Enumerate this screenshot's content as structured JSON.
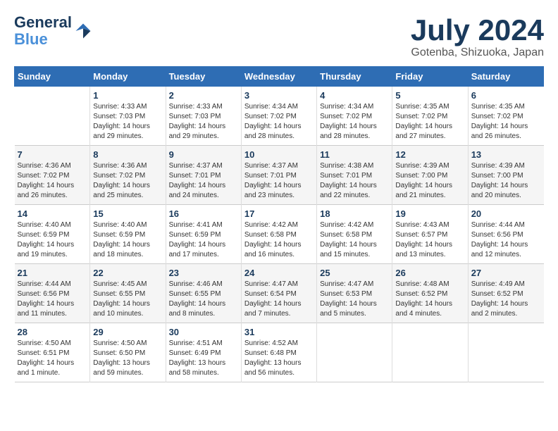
{
  "header": {
    "logo_line1": "General",
    "logo_line2": "Blue",
    "month_title": "July 2024",
    "subtitle": "Gotenba, Shizuoka, Japan"
  },
  "calendar": {
    "days_of_week": [
      "Sunday",
      "Monday",
      "Tuesday",
      "Wednesday",
      "Thursday",
      "Friday",
      "Saturday"
    ],
    "weeks": [
      [
        {
          "day": "",
          "info": ""
        },
        {
          "day": "1",
          "info": "Sunrise: 4:33 AM\nSunset: 7:03 PM\nDaylight: 14 hours\nand 29 minutes."
        },
        {
          "day": "2",
          "info": "Sunrise: 4:33 AM\nSunset: 7:03 PM\nDaylight: 14 hours\nand 29 minutes."
        },
        {
          "day": "3",
          "info": "Sunrise: 4:34 AM\nSunset: 7:02 PM\nDaylight: 14 hours\nand 28 minutes."
        },
        {
          "day": "4",
          "info": "Sunrise: 4:34 AM\nSunset: 7:02 PM\nDaylight: 14 hours\nand 28 minutes."
        },
        {
          "day": "5",
          "info": "Sunrise: 4:35 AM\nSunset: 7:02 PM\nDaylight: 14 hours\nand 27 minutes."
        },
        {
          "day": "6",
          "info": "Sunrise: 4:35 AM\nSunset: 7:02 PM\nDaylight: 14 hours\nand 26 minutes."
        }
      ],
      [
        {
          "day": "7",
          "info": "Sunrise: 4:36 AM\nSunset: 7:02 PM\nDaylight: 14 hours\nand 26 minutes."
        },
        {
          "day": "8",
          "info": "Sunrise: 4:36 AM\nSunset: 7:02 PM\nDaylight: 14 hours\nand 25 minutes."
        },
        {
          "day": "9",
          "info": "Sunrise: 4:37 AM\nSunset: 7:01 PM\nDaylight: 14 hours\nand 24 minutes."
        },
        {
          "day": "10",
          "info": "Sunrise: 4:37 AM\nSunset: 7:01 PM\nDaylight: 14 hours\nand 23 minutes."
        },
        {
          "day": "11",
          "info": "Sunrise: 4:38 AM\nSunset: 7:01 PM\nDaylight: 14 hours\nand 22 minutes."
        },
        {
          "day": "12",
          "info": "Sunrise: 4:39 AM\nSunset: 7:00 PM\nDaylight: 14 hours\nand 21 minutes."
        },
        {
          "day": "13",
          "info": "Sunrise: 4:39 AM\nSunset: 7:00 PM\nDaylight: 14 hours\nand 20 minutes."
        }
      ],
      [
        {
          "day": "14",
          "info": "Sunrise: 4:40 AM\nSunset: 6:59 PM\nDaylight: 14 hours\nand 19 minutes."
        },
        {
          "day": "15",
          "info": "Sunrise: 4:40 AM\nSunset: 6:59 PM\nDaylight: 14 hours\nand 18 minutes."
        },
        {
          "day": "16",
          "info": "Sunrise: 4:41 AM\nSunset: 6:59 PM\nDaylight: 14 hours\nand 17 minutes."
        },
        {
          "day": "17",
          "info": "Sunrise: 4:42 AM\nSunset: 6:58 PM\nDaylight: 14 hours\nand 16 minutes."
        },
        {
          "day": "18",
          "info": "Sunrise: 4:42 AM\nSunset: 6:58 PM\nDaylight: 14 hours\nand 15 minutes."
        },
        {
          "day": "19",
          "info": "Sunrise: 4:43 AM\nSunset: 6:57 PM\nDaylight: 14 hours\nand 13 minutes."
        },
        {
          "day": "20",
          "info": "Sunrise: 4:44 AM\nSunset: 6:56 PM\nDaylight: 14 hours\nand 12 minutes."
        }
      ],
      [
        {
          "day": "21",
          "info": "Sunrise: 4:44 AM\nSunset: 6:56 PM\nDaylight: 14 hours\nand 11 minutes."
        },
        {
          "day": "22",
          "info": "Sunrise: 4:45 AM\nSunset: 6:55 PM\nDaylight: 14 hours\nand 10 minutes."
        },
        {
          "day": "23",
          "info": "Sunrise: 4:46 AM\nSunset: 6:55 PM\nDaylight: 14 hours\nand 8 minutes."
        },
        {
          "day": "24",
          "info": "Sunrise: 4:47 AM\nSunset: 6:54 PM\nDaylight: 14 hours\nand 7 minutes."
        },
        {
          "day": "25",
          "info": "Sunrise: 4:47 AM\nSunset: 6:53 PM\nDaylight: 14 hours\nand 5 minutes."
        },
        {
          "day": "26",
          "info": "Sunrise: 4:48 AM\nSunset: 6:52 PM\nDaylight: 14 hours\nand 4 minutes."
        },
        {
          "day": "27",
          "info": "Sunrise: 4:49 AM\nSunset: 6:52 PM\nDaylight: 14 hours\nand 2 minutes."
        }
      ],
      [
        {
          "day": "28",
          "info": "Sunrise: 4:50 AM\nSunset: 6:51 PM\nDaylight: 14 hours\nand 1 minute."
        },
        {
          "day": "29",
          "info": "Sunrise: 4:50 AM\nSunset: 6:50 PM\nDaylight: 13 hours\nand 59 minutes."
        },
        {
          "day": "30",
          "info": "Sunrise: 4:51 AM\nSunset: 6:49 PM\nDaylight: 13 hours\nand 58 minutes."
        },
        {
          "day": "31",
          "info": "Sunrise: 4:52 AM\nSunset: 6:48 PM\nDaylight: 13 hours\nand 56 minutes."
        },
        {
          "day": "",
          "info": ""
        },
        {
          "day": "",
          "info": ""
        },
        {
          "day": "",
          "info": ""
        }
      ]
    ]
  }
}
